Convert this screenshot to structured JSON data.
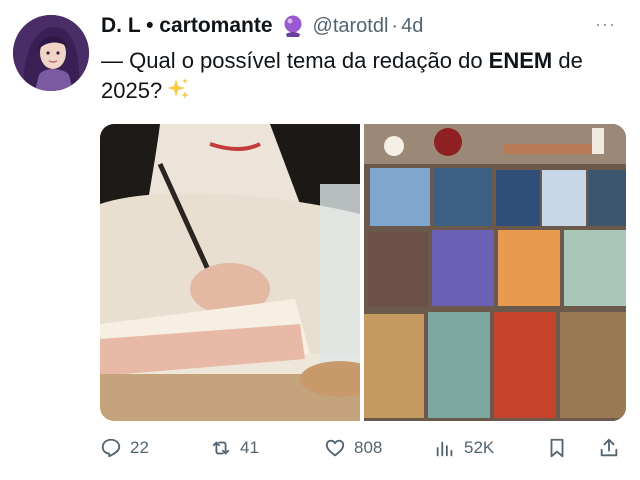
{
  "tweet": {
    "author_name": "D. L • cartomante",
    "handle": "@tarotdl",
    "separator": "·",
    "time": "4d",
    "more": "···",
    "text_prefix": "— Qual o possível tema da redação do ",
    "text_bold": "ENEM",
    "text_suffix": " de 2025?",
    "emoji_after_name": "crystal-ball",
    "emoji_after_text": "sparkles"
  },
  "actions": {
    "replies": "22",
    "reposts": "41",
    "likes": "808",
    "views": "52K"
  },
  "colors": {
    "text": "#0f1419",
    "secondary": "#536471",
    "background": "#ffffff"
  }
}
